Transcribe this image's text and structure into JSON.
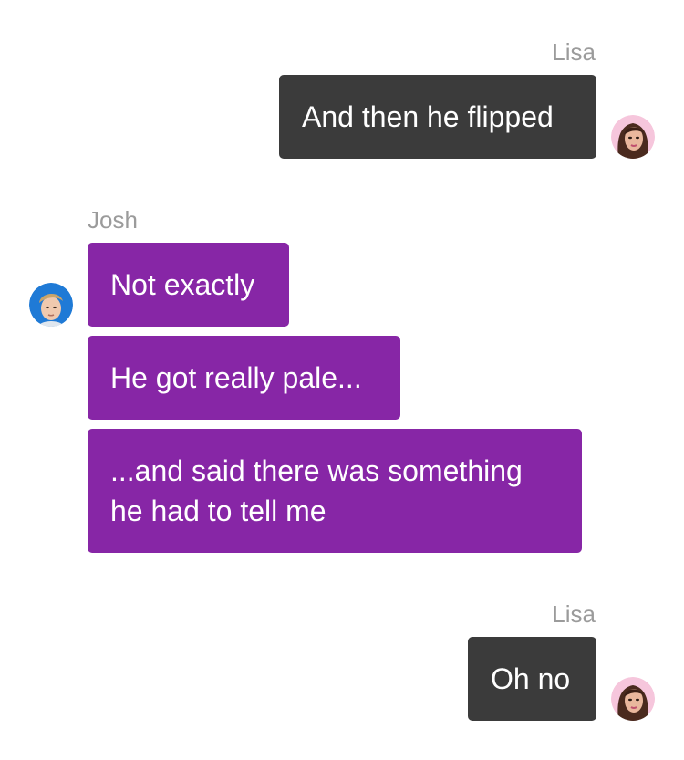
{
  "messages": [
    {
      "sender": "Lisa",
      "text": "And then he flipped"
    },
    {
      "sender": "Josh",
      "text": "Not exactly"
    },
    {
      "sender": "Josh",
      "text": "He got really pale..."
    },
    {
      "sender": "Josh",
      "text": "...and said there was something he had to tell me"
    },
    {
      "sender": "Lisa",
      "text": "Oh no"
    }
  ],
  "colors": {
    "outgoing_bubble": "#3b3b3b",
    "incoming_bubble": "#8726a6",
    "sender_name": "#9b9b9b"
  },
  "avatars": {
    "lisa": "lisa-avatar-icon",
    "josh": "josh-avatar-icon"
  }
}
